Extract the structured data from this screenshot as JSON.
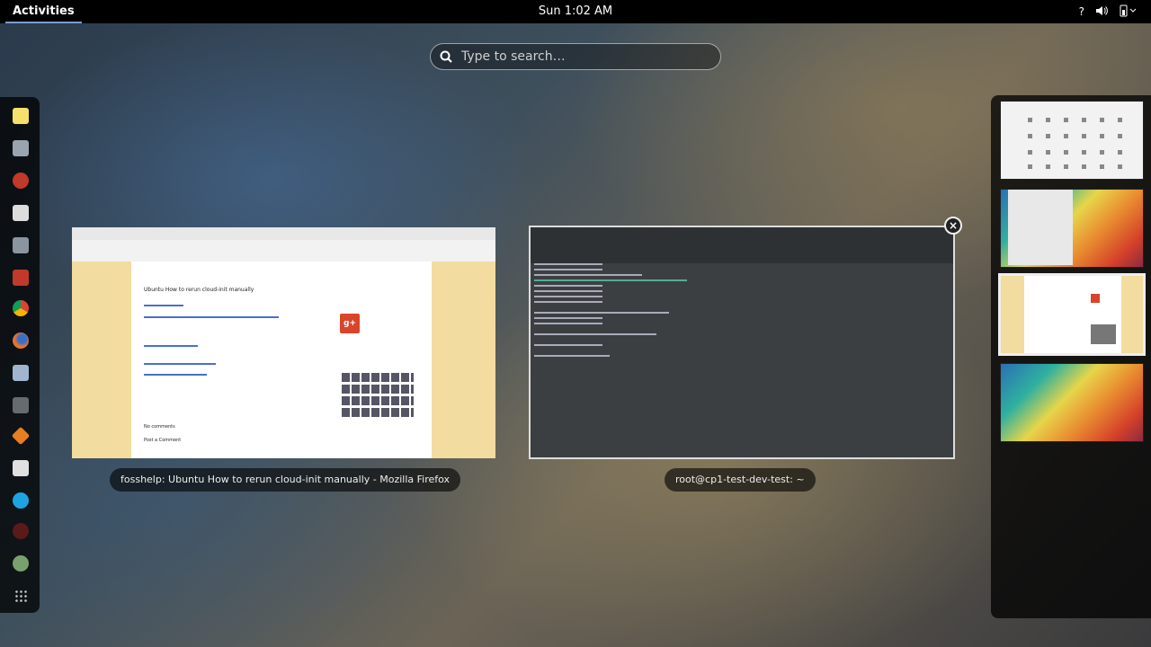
{
  "topbar": {
    "activities": "Activities",
    "clock": "Sun  1:02 AM",
    "help_icon": "?",
    "volume_icon": "speaker-icon",
    "power_icon": "power-icon"
  },
  "search": {
    "placeholder": "Type to search…"
  },
  "dash": {
    "apps": [
      {
        "name": "notes-icon",
        "color": "#f4e06a"
      },
      {
        "name": "files-icon",
        "color": "#9aa4ae"
      },
      {
        "name": "multimedia-icon",
        "color": "#c0392b"
      },
      {
        "name": "text-editor-icon",
        "color": "#dddddd"
      },
      {
        "name": "screenshot-icon",
        "color": "#8a95a0"
      },
      {
        "name": "presentation-icon",
        "color": "#c0392b"
      },
      {
        "name": "chrome-icon",
        "color": "#e4a11b"
      },
      {
        "name": "firefox-icon",
        "color": "#e8732a"
      },
      {
        "name": "calculator-icon",
        "color": "#a0b6cc"
      },
      {
        "name": "terminal-icon",
        "color": "#666b70"
      },
      {
        "name": "package-icon",
        "color": "#e67e22"
      },
      {
        "name": "document-icon",
        "color": "#e0e0e0"
      },
      {
        "name": "skype-icon",
        "color": "#1fa3e0"
      },
      {
        "name": "dark-app-icon",
        "color": "#5a1a1a"
      },
      {
        "name": "fox-icon",
        "color": "#7aa070"
      }
    ]
  },
  "windows": {
    "firefox": {
      "caption": "fosshelp: Ubuntu How to rerun cloud-init manually - Mozilla Firefox",
      "page_title": "Ubuntu How to rerun cloud-init manually",
      "comments": "No comments",
      "post_comment": "Post a Comment"
    },
    "terminal": {
      "caption": "root@cp1-test-dev-test: ~"
    }
  },
  "workspaces": [
    "workspace-1",
    "workspace-2",
    "workspace-3",
    "workspace-4"
  ]
}
